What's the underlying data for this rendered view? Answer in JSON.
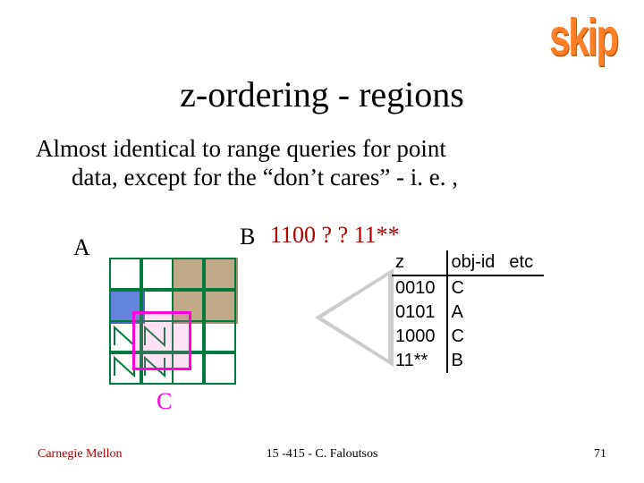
{
  "title": "z-ordering - regions",
  "skip": "skip",
  "body_line1": "Almost identical to range queries for point",
  "body_line2": "data, except for the “don’t cares” - i. e. ,",
  "labels": {
    "A": "A",
    "B": "B",
    "C": "C"
  },
  "bitstring": "1100 ? ? 11**",
  "table": {
    "headers": {
      "z": "z",
      "obj": "obj-id",
      "etc": "etc"
    },
    "rows": [
      {
        "z": "0010",
        "obj": "C"
      },
      {
        "z": "0101",
        "obj": "A"
      },
      {
        "z": "1000",
        "obj": "C"
      },
      {
        "z": "11**",
        "obj": "B"
      }
    ]
  },
  "footer": {
    "left": "Carnegie Mellon",
    "center": "15 -415 - C. Faloutsos",
    "right": "71"
  }
}
